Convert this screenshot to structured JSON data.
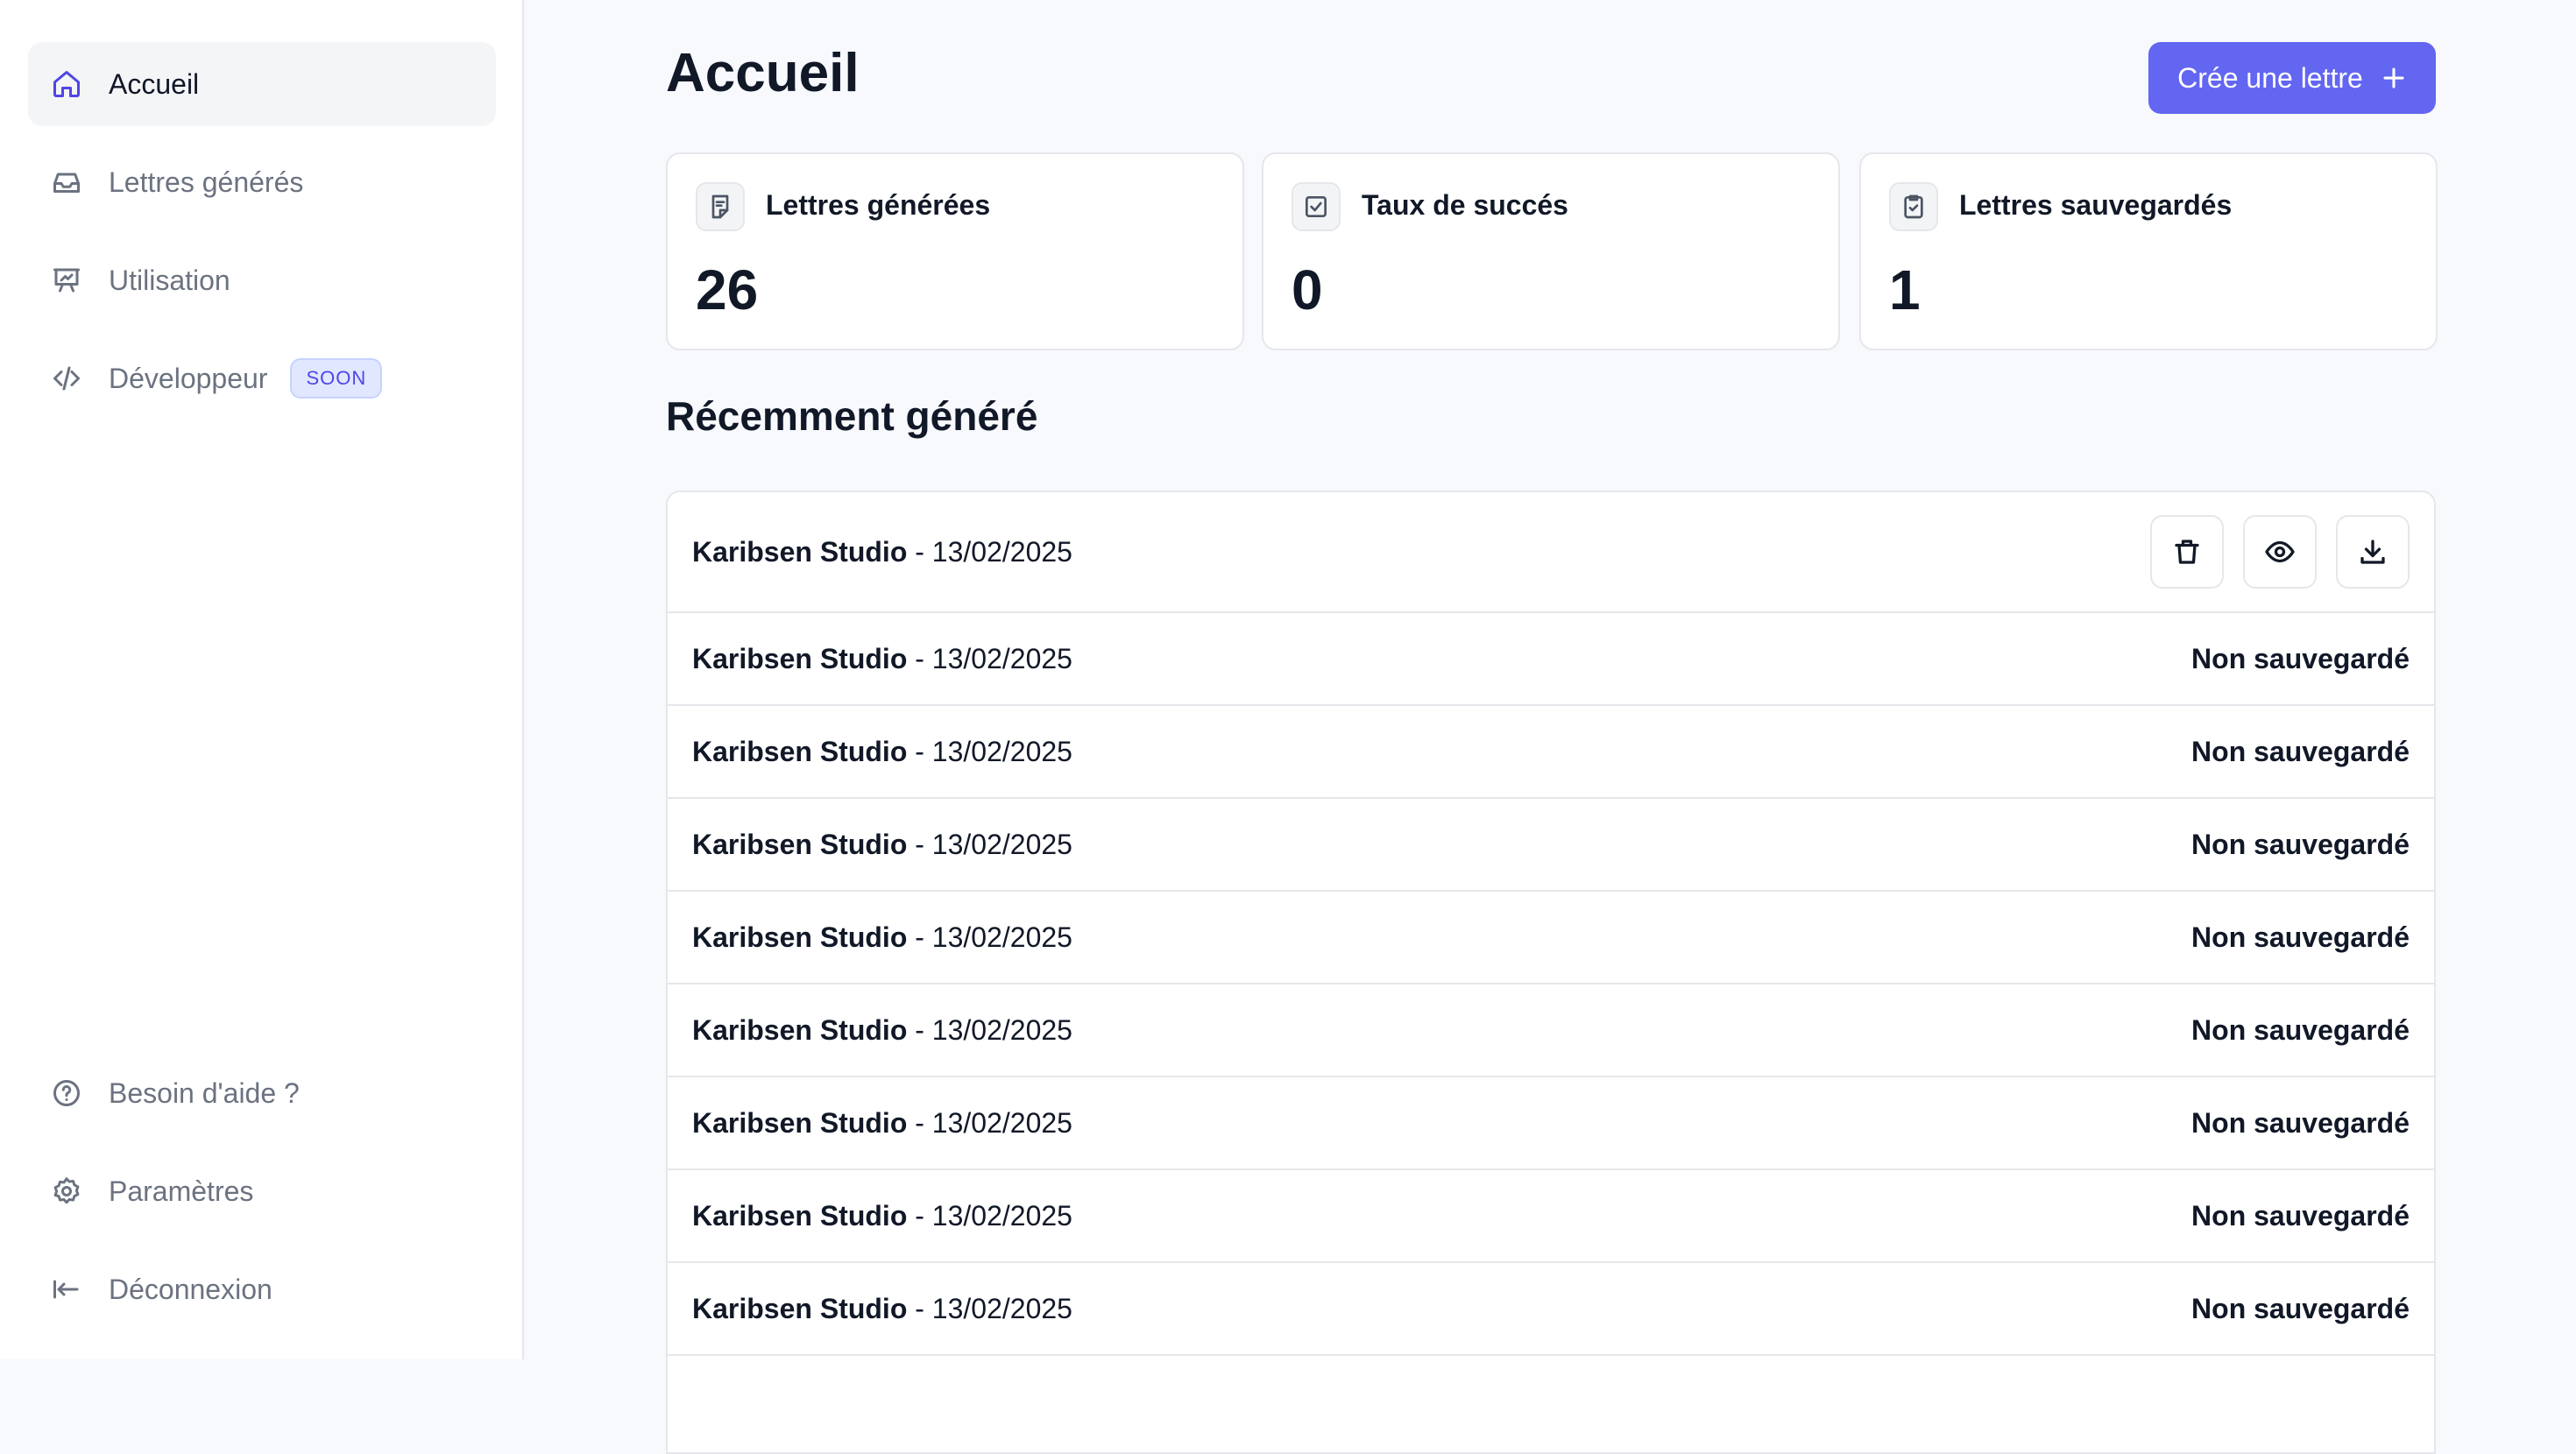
{
  "sidebar": {
    "nav": [
      {
        "label": "Accueil",
        "icon": "home-icon",
        "active": true
      },
      {
        "label": "Lettres générés",
        "icon": "inbox-icon"
      },
      {
        "label": "Utilisation",
        "icon": "presentation-chart-icon"
      },
      {
        "label": "Développeur",
        "icon": "code-icon",
        "badge": "SOON"
      }
    ],
    "footer": [
      {
        "label": "Besoin d'aide ?",
        "icon": "help-circle-icon"
      },
      {
        "label": "Paramètres",
        "icon": "gear-icon"
      },
      {
        "label": "Déconnexion",
        "icon": "logout-icon"
      }
    ]
  },
  "header": {
    "title": "Accueil",
    "create_label": "Crée une lettre"
  },
  "stats": [
    {
      "label": "Lettres générées",
      "value": "26",
      "icon": "document-icon"
    },
    {
      "label": "Taux de succés",
      "value": "0",
      "icon": "checkbox-icon"
    },
    {
      "label": "Lettres sauvegardés",
      "value": "1",
      "icon": "clipboard-check-icon"
    }
  ],
  "recent": {
    "title": "Récemment généré",
    "rows": [
      {
        "company": "Karibsen Studio",
        "date": " - 13/02/2025",
        "status": ""
      },
      {
        "company": "Karibsen Studio",
        "date": " - 13/02/2025",
        "status": "Non sauvegardé"
      },
      {
        "company": "Karibsen Studio",
        "date": " - 13/02/2025",
        "status": "Non sauvegardé"
      },
      {
        "company": "Karibsen Studio",
        "date": " - 13/02/2025",
        "status": "Non sauvegardé"
      },
      {
        "company": "Karibsen Studio",
        "date": " - 13/02/2025",
        "status": "Non sauvegardé"
      },
      {
        "company": "Karibsen Studio",
        "date": " - 13/02/2025",
        "status": "Non sauvegardé"
      },
      {
        "company": "Karibsen Studio",
        "date": " - 13/02/2025",
        "status": "Non sauvegardé"
      },
      {
        "company": "Karibsen Studio",
        "date": " - 13/02/2025",
        "status": "Non sauvegardé"
      },
      {
        "company": "Karibsen Studio",
        "date": " - 13/02/2025",
        "status": "Non sauvegardé"
      }
    ]
  },
  "colors": {
    "accent": "#6366f1",
    "background": "#f7f9fc",
    "border": "#e5e7eb"
  }
}
